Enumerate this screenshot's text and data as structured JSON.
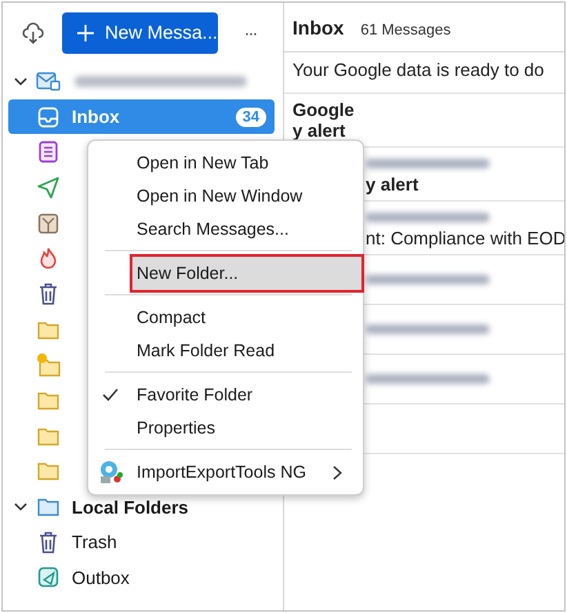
{
  "toolbar": {
    "new_message": "New Messa...",
    "more": "···"
  },
  "folder_tree": [
    {
      "kind": "account",
      "expanded": true,
      "children": [
        {
          "kind": "inbox",
          "label": "Inbox",
          "count": "34",
          "selected": true
        },
        {
          "kind": "drafts",
          "selected": false
        },
        {
          "kind": "sent",
          "selected": false
        },
        {
          "kind": "archive",
          "selected": false
        },
        {
          "kind": "junk",
          "selected": false
        },
        {
          "kind": "trash",
          "selected": false
        },
        {
          "kind": "folder",
          "selected": false
        },
        {
          "kind": "folder-dot",
          "selected": false
        },
        {
          "kind": "folder",
          "selected": false
        },
        {
          "kind": "folder",
          "selected": false
        },
        {
          "kind": "folder",
          "selected": false
        }
      ]
    },
    {
      "kind": "local",
      "label": "Local Folders",
      "expanded": true,
      "children": [
        {
          "kind": "trash",
          "label": "Trash",
          "selected": false
        },
        {
          "kind": "outbox",
          "label": "Outbox",
          "selected": false
        }
      ]
    }
  ],
  "message_list": {
    "title": "Inbox",
    "count": "61 Messages",
    "rows": [
      {
        "kind": "full",
        "subject": "Your Google data is ready to do"
      },
      {
        "kind": "full",
        "sender": "Google",
        "subject": "y alert"
      },
      {
        "kind": "partial",
        "blurred_sender": true,
        "subject": "y alert"
      },
      {
        "kind": "partial",
        "blurred_sender": true,
        "subject": "nt: Compliance with EOD"
      },
      {
        "kind": "partial",
        "blurred_sender": true
      },
      {
        "kind": "partial",
        "blurred_sender": true
      },
      {
        "kind": "partial",
        "blurred_sender": true
      },
      {
        "kind": "partial"
      }
    ]
  },
  "context_menu": [
    {
      "kind": "item",
      "label": "Open in New Tab",
      "selected": false
    },
    {
      "kind": "item",
      "label": "Open in New Window",
      "selected": false
    },
    {
      "kind": "item",
      "label": "Search Messages...",
      "selected": false
    },
    {
      "kind": "separator"
    },
    {
      "kind": "item",
      "label": "New Folder...",
      "selected": true
    },
    {
      "kind": "separator"
    },
    {
      "kind": "item",
      "label": "Compact",
      "selected": false
    },
    {
      "kind": "item",
      "label": "Mark Folder Read",
      "selected": false
    },
    {
      "kind": "separator"
    },
    {
      "kind": "check",
      "label": "Favorite Folder",
      "checked": true,
      "selected": false
    },
    {
      "kind": "item",
      "label": "Properties",
      "selected": false
    },
    {
      "kind": "separator"
    },
    {
      "kind": "submenu",
      "label": "ImportExportTools NG",
      "selected": false
    }
  ]
}
